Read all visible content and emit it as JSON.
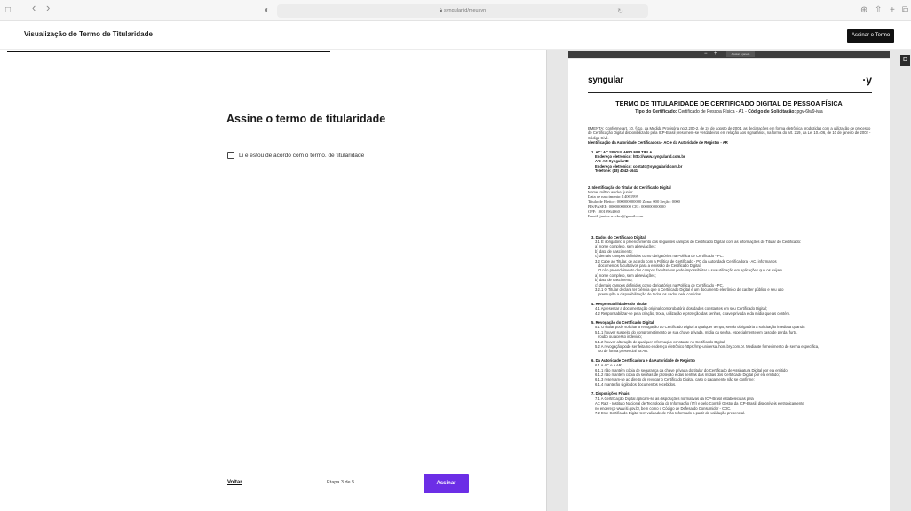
{
  "browser": {
    "url": "syngular.id/meusyn",
    "sidebar_icon": "□",
    "back_icon": "‹",
    "forward_icon": "›",
    "shield_icon": "◐",
    "reload_icon": "↻",
    "download_icon": "⊕",
    "share_icon": "⇧",
    "newtab_icon": "+",
    "tabs_icon": "⧉"
  },
  "header": {
    "title": "Visualização do Termo de Titularidade",
    "sign_button": "Assinar o Termo"
  },
  "form": {
    "title": "Assine o termo de titularidade",
    "checkbox_label": "Li e estou de acordo com o termo. de titularidade",
    "back_label": "Voltar",
    "step_label": "Etapa 3 de 5",
    "submit_label": "Assinar"
  },
  "viewer": {
    "zoom_out": "−",
    "zoom_in": "+",
    "fit_label": "Ajustar à janela",
    "download_icon": "D"
  },
  "document": {
    "brand": "syngular",
    "brand_mark": "·y",
    "title": "TERMO DE TITULARIDADE DE CERTIFICADO DIGITAL DE PESSOA FÍSICA",
    "subtitle_label": "Tipo do Certificado:",
    "subtitle_value": "Certificado de Pessoa Física - A1 -",
    "request_label": "Código de Solicitação:",
    "request_value": "pgv-6lw9-iwa",
    "ementa": "EMENTA: Conforme art. 10, § 1o, da Medida Provisória no 2.200-2, de 24 de agosto de 2001, as declarações em forma eletrônica produzidas com a utilização de processo de Certificação Digital disponibilizado pela ICP-Brasil presumem-se verdadeiras em relação aos signatários, na forma do art. 219, da Lei 10.406, de 10 de janeiro de 2002 - Código Civil.",
    "ident_ac": "Identificação da Autoridade Certificadora - AC e da Autoridade de Registro - AR",
    "ac_lines": [
      "1. AC: AC SINGULARID MULTIPLA",
      "Endereço eletrônico: http://www.syngularid.com.br",
      "AR: AR SyngularID",
      "Endereço eletrônico: contato@syngularid.com.br",
      "Telefone: (48) 4042-1641"
    ],
    "titular_heading": "2. Identificação do Titular do Certificado Digital",
    "titular_lines": [
      "Nome: milton wecker junior",
      "Data de nascimento: 14061999",
      "Título de Eleitor: 000000000000 Zona: 000 Seção: 0000",
      "PIS/PASEP: 00000000000 CEI: 000000000000",
      "CPF: 10019964960",
      "Email: junior.wecker@gmail.com"
    ],
    "s3_heading": "3. Dados do Certificado Digital",
    "s3_lines": [
      "3.1 É obrigatório o preenchimento dos seguintes campos do Certificado Digital, com as informações do Titular do Certificado:",
      "a) nome completo, sem abreviações;",
      "b) data de nascimento;",
      "c) demais campos definidos como obrigatórios na Política de Certificado - PC.",
      "3.2 Cabe ao Titular, de acordo com a Política de Certificado - PC da Autoridade Certificadora - AC, informar os",
      "documentos facultativos para a emissão do Certificado Digital.",
      "O não preenchimento dos campos facultativos pode impossibilitar a sua utilização em aplicações que os exijam.",
      "a) nome completo, sem abreviações;",
      "b) data de nascimento;",
      "c) demais campos definidos como obrigatórios na Política de Certificado - PC.",
      "3.2.1 O Titular declara ter ciência que o Certificado Digital é um documento eletrônico de caráter público e seu uso",
      "pressupõe a disponibilização de todos os dados nele contidos."
    ],
    "s4_heading": "4. Responsabilidades do Titular",
    "s4_lines": [
      "4.1 Apresentar a documentação original comprobatória dos dados constantes em seu Certificado Digital;",
      "4.2 Responsabilizar-se pela criação, troca, utilização e proteção das senhas, chave privada e da mídia que as contém."
    ],
    "s5_heading": "5. Revogação do Certificado Digital",
    "s5_lines": [
      "5.1 O titular pode solicitar a revogação do Certificado Digital a qualquer tempo, sendo obrigatória a solicitação imediata quando:",
      "5.1.1 houver suspeita do comprometimento de sua chave privada, mídia ou senha, especialmente em caso de perda, furto,",
      "roubo ou acesso indevido;",
      "5.1.2 houver alteração de qualquer informação constante no Certificado Digital.",
      "5.2 A revogação pode ser feita no endereço eletrônico https://mp-universal.hom.bry.com.br. Mediante fornecimento de senha específica,",
      "ou de forma presencial na AR."
    ],
    "s6_heading": "6. Da Autoridade Certificadora e da Autoridade de Registro",
    "s6_lines": [
      "6.1 A AC e a AR:",
      "6.1.1 não mantém cópia de segurança da chave privada do titular do Certificado de Assinatura Digital por ela emitido;",
      "6.1.2 não mantém cópia da senhas de proteção e das senhas das mídias dos Certificado Digital por ela emitido;",
      "6.1.3 reservam-se ao direito de revogar o Certificado Digital, caso o pagamento não se confirme;",
      "6.1.4 manterão sigilo dos documentos recebidos."
    ],
    "s7_heading": "7. Disposições Finais",
    "s7_lines": [
      "7.1 A Certificação Digital aplicam-se as disposições normativas da ICP-Brasil estabelecidas pela",
      "AC Raiz - Instituto Nacional de Tecnologia da Informação (ITI) e pelo Comitê Gestor da ICP-Brasil, disponíveis eletronicamente",
      "no endereço www.iti.gov.br, bem como o Código de Defesa do Consumidor - CDC.",
      "7.2 Este Certificado Digital tem validade de Não Informado a partir da validação presencial."
    ]
  }
}
